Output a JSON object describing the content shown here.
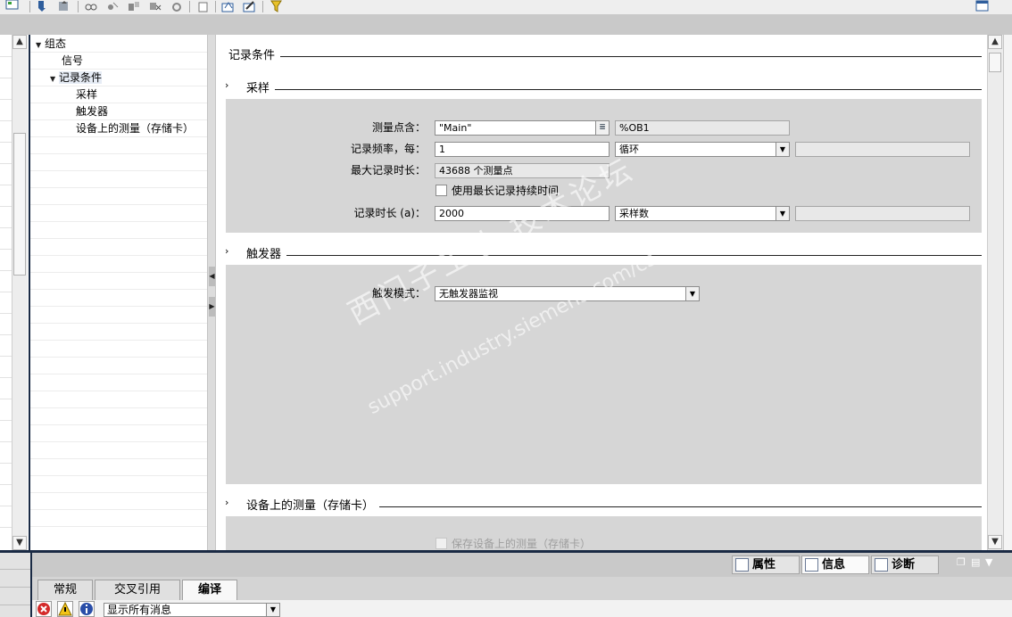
{
  "tree": {
    "items": [
      {
        "label": "组态",
        "expanded": true
      },
      {
        "label": "信号"
      },
      {
        "label": "记录条件",
        "expanded": true,
        "selected": true
      },
      {
        "label": "采样"
      },
      {
        "label": "触发器"
      },
      {
        "label": "设备上的测量（存储卡）"
      }
    ]
  },
  "main": {
    "title": "记录条件",
    "sampling": {
      "title": "采样",
      "measure_point_label": "测量点含：",
      "measure_point_value": "\"Main\"",
      "measure_point_ob": "%OB1",
      "record_freq_label": "记录频率，每：",
      "record_freq_value": "1",
      "record_freq_unit": "循环",
      "max_duration_label": "最大记录时长：",
      "max_duration_value": "43688 个测量点",
      "use_max_label": "使用最长记录持续时间",
      "use_max_checked": false,
      "duration_label": "记录时长 (a)：",
      "duration_value": "2000",
      "duration_unit": "采样数"
    },
    "trigger": {
      "title": "触发器",
      "mode_label": "触发模式：",
      "mode_value": "无触发器监视"
    },
    "device": {
      "title": "设备上的测量（存储卡）",
      "save_label": "保存设备上的测量（存储卡）",
      "save_checked": false
    }
  },
  "watermark": {
    "line1": "西门子工业 技术论坛",
    "line2": "support.industry.siemens.com/cs"
  },
  "inspector": {
    "tabs": [
      "属性",
      "信息",
      "诊断"
    ],
    "active_tab": "信息"
  },
  "bottom": {
    "tabs": [
      "常规",
      "交叉引用",
      "编译"
    ],
    "active_tab": "编译",
    "filter_value": "显示所有消息"
  },
  "colors": {
    "dark_frame": "#1a2a44",
    "section_bg": "#d6d6d6",
    "error_icon": "#d42a2a",
    "warning_icon": "#f2c318",
    "info_icon": "#2a4ea8"
  },
  "icons": {
    "toolbar": [
      "download-icon",
      "upload-icon",
      "connect-icon",
      "disconnect-icon",
      "compare-icon",
      "delete-icon",
      "refresh-icon",
      "export-icon",
      "import-icon",
      "edit-icon",
      "filter-icon"
    ],
    "properties_tab": "properties-icon",
    "info_tab": "info-icon",
    "diagnostics_tab": "diagnostics-icon"
  }
}
